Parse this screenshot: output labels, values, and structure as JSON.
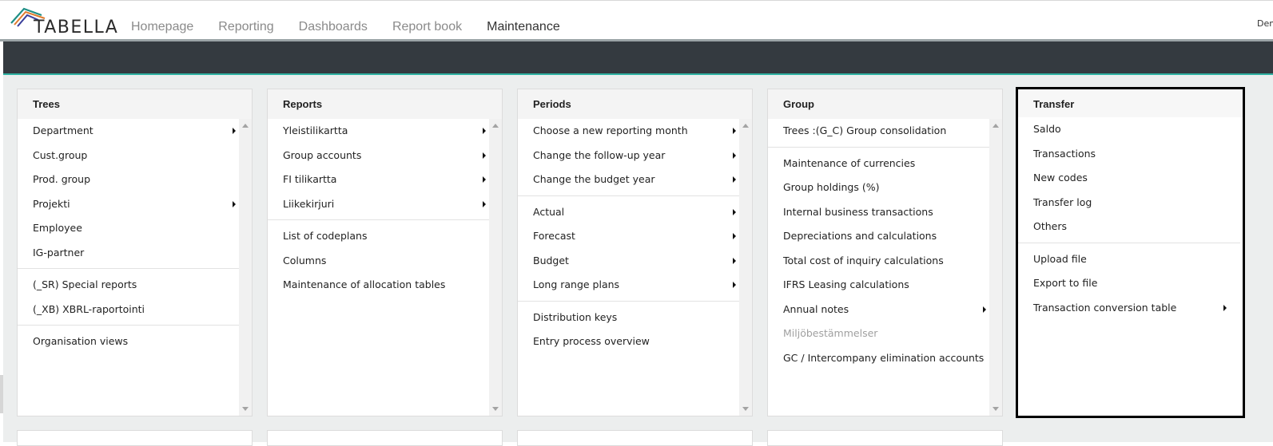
{
  "app": {
    "logo_text": "TABELLA",
    "user": "Demo"
  },
  "nav": [
    {
      "label": "Homepage",
      "active": false
    },
    {
      "label": "Reporting",
      "active": false
    },
    {
      "label": "Dashboards",
      "active": false
    },
    {
      "label": "Report book",
      "active": false
    },
    {
      "label": "Maintenance",
      "active": true
    }
  ],
  "colors": {
    "accent": "#2fb2a3",
    "header_bar": "#343a40",
    "background": "#eceeee"
  },
  "panels": [
    {
      "title": "Trees",
      "groups": [
        [
          {
            "label": "Department",
            "submenu": true
          },
          {
            "label": "Cust.group",
            "submenu": false
          },
          {
            "label": "Prod. group",
            "submenu": false
          },
          {
            "label": "Projekti",
            "submenu": true
          },
          {
            "label": "Employee",
            "submenu": false
          },
          {
            "label": "IG-partner",
            "submenu": false
          }
        ],
        [
          {
            "label": "(_SR) Special reports",
            "submenu": false
          },
          {
            "label": "(_XB) XBRL-raportointi",
            "submenu": false
          }
        ],
        [
          {
            "label": "Organisation views",
            "submenu": false
          }
        ]
      ]
    },
    {
      "title": "Reports",
      "groups": [
        [
          {
            "label": "Yleistilikartta",
            "submenu": true
          },
          {
            "label": "Group accounts",
            "submenu": true
          },
          {
            "label": "FI tilikartta",
            "submenu": true
          },
          {
            "label": "Liikekirjuri",
            "submenu": true
          }
        ],
        [
          {
            "label": "List of codeplans",
            "submenu": false
          },
          {
            "label": "Columns",
            "submenu": false
          },
          {
            "label": "Maintenance of allocation tables",
            "submenu": false
          }
        ]
      ]
    },
    {
      "title": "Periods",
      "groups": [
        [
          {
            "label": "Choose a new reporting month",
            "submenu": true
          },
          {
            "label": "Change the follow-up year",
            "submenu": true
          },
          {
            "label": "Change the budget year",
            "submenu": true
          }
        ],
        [
          {
            "label": "Actual",
            "submenu": true
          },
          {
            "label": "Forecast",
            "submenu": true
          },
          {
            "label": "Budget",
            "submenu": true
          },
          {
            "label": "Long range plans",
            "submenu": true
          }
        ],
        [
          {
            "label": "Distribution keys",
            "submenu": false
          },
          {
            "label": "Entry process overview",
            "submenu": false
          }
        ]
      ]
    },
    {
      "title": "Group",
      "groups": [
        [
          {
            "label": "Trees :(G_C) Group consolidation",
            "submenu": false
          }
        ],
        [
          {
            "label": "Maintenance of currencies",
            "submenu": false
          },
          {
            "label": "Group holdings (%)",
            "submenu": false
          },
          {
            "label": "Internal business transactions",
            "submenu": false
          },
          {
            "label": "Depreciations and calculations",
            "submenu": false
          },
          {
            "label": "Total cost of inquiry calculations",
            "submenu": false
          },
          {
            "label": "IFRS Leasing calculations",
            "submenu": false
          },
          {
            "label": "Annual notes",
            "submenu": true
          },
          {
            "label": "Miljöbestämmelser",
            "submenu": false,
            "disabled": true
          },
          {
            "label": "GC / Intercompany elimination accounts",
            "submenu": false
          }
        ]
      ]
    },
    {
      "title": "Transfer",
      "selected": true,
      "groups": [
        [
          {
            "label": "Saldo",
            "submenu": false
          },
          {
            "label": "Transactions",
            "submenu": false
          },
          {
            "label": "New codes",
            "submenu": false
          },
          {
            "label": "Transfer log",
            "submenu": false
          },
          {
            "label": "Others",
            "submenu": false
          }
        ],
        [
          {
            "label": "Upload file",
            "submenu": false
          },
          {
            "label": "Export to file",
            "submenu": false
          },
          {
            "label": "Transaction conversion table",
            "submenu": true
          }
        ]
      ]
    }
  ]
}
